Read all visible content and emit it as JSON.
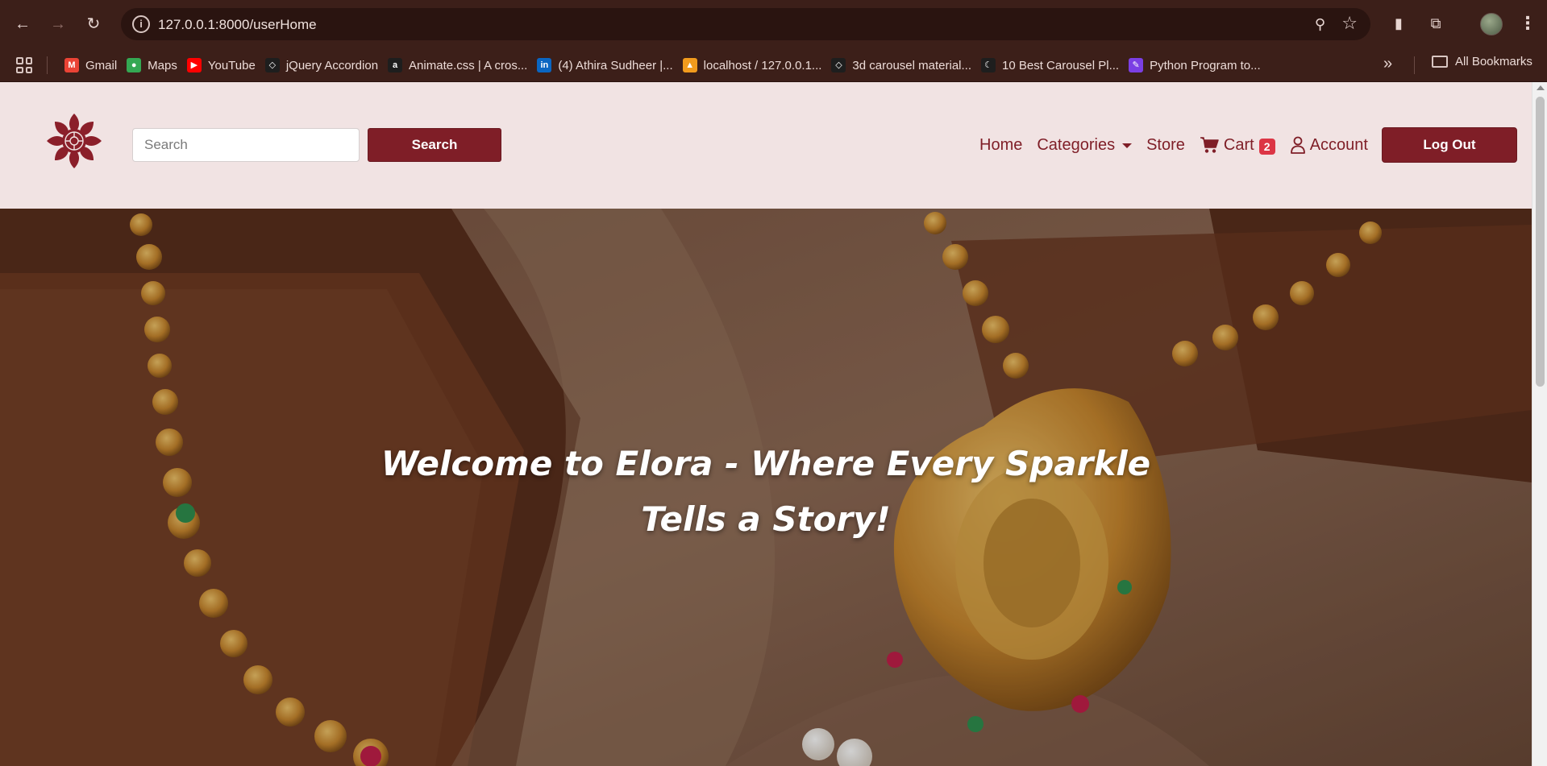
{
  "browser": {
    "url": "127.0.0.1:8000/userHome",
    "bookmarks": [
      {
        "label": "Gmail",
        "icon": "gmail-icon",
        "color": "#ea4335",
        "glyph": "M"
      },
      {
        "label": "Maps",
        "icon": "maps-icon",
        "color": "#34a853",
        "glyph": "●"
      },
      {
        "label": "YouTube",
        "icon": "youtube-icon",
        "color": "#ff0000",
        "glyph": "▶"
      },
      {
        "label": "jQuery Accordion",
        "icon": "codepen-icon",
        "color": "#1e1e1e",
        "glyph": "◇"
      },
      {
        "label": "Animate.css | A cros...",
        "icon": "animate-icon",
        "color": "#1e1e1e",
        "glyph": "a"
      },
      {
        "label": "(4) Athira Sudheer |...",
        "icon": "linkedin-icon",
        "color": "#0a66c2",
        "glyph": "in"
      },
      {
        "label": "localhost / 127.0.0.1...",
        "icon": "phpmyadmin-icon",
        "color": "#f29b1d",
        "glyph": "▲"
      },
      {
        "label": "3d carousel material...",
        "icon": "codepen-icon",
        "color": "#1e1e1e",
        "glyph": "◇"
      },
      {
        "label": "10 Best Carousel Pl...",
        "icon": "moon-icon",
        "color": "#1e1e1e",
        "glyph": "☾"
      },
      {
        "label": "Python Program to...",
        "icon": "pen-icon",
        "color": "#7b3fe4",
        "glyph": "✎"
      }
    ],
    "all_bookmarks": "All Bookmarks"
  },
  "header": {
    "search_placeholder": "Search",
    "search_button": "Search",
    "nav": {
      "home": "Home",
      "categories": "Categories",
      "store": "Store",
      "cart": "Cart",
      "cart_count": "2",
      "account": "Account"
    },
    "logout": "Log Out"
  },
  "hero": {
    "title_line1": "Welcome to Elora - Where Every Sparkle",
    "title_line2": "Tells a Story!"
  },
  "colors": {
    "brand": "#7f1e27",
    "header_bg": "#f1e3e3",
    "badge": "#dc3545"
  }
}
